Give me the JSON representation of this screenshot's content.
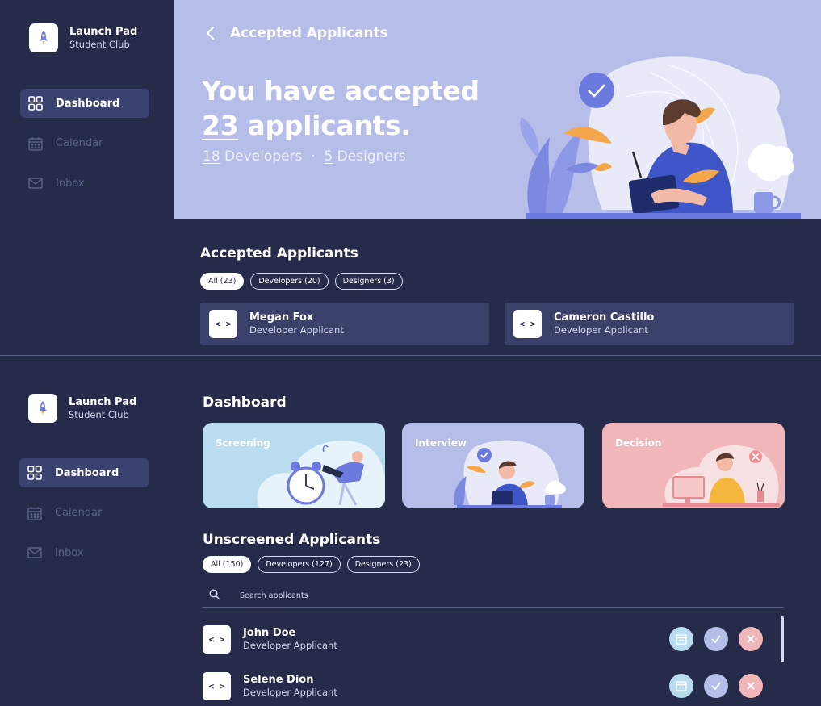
{
  "brand": {
    "name": "Launch Pad",
    "subtitle": "Student Club"
  },
  "nav": {
    "dashboard": "Dashboard",
    "calendar": "Calendar",
    "inbox": "Inbox"
  },
  "accepted_view": {
    "breadcrumb": "Accepted Applicants",
    "headline_prefix": "You have accepted",
    "headline_count": "23",
    "headline_suffix": " applicants.",
    "dev_count": "18",
    "dev_label": " Developers",
    "separator": "  ·  ",
    "design_count": "5",
    "design_label": " Designers",
    "section_title": "Accepted Applicants",
    "filters": [
      "All (23)",
      "Developers (20)",
      "Designers (3)"
    ],
    "applicants": [
      {
        "name": "Megan Fox",
        "role": "Developer Applicant",
        "icon": "< >"
      },
      {
        "name": "Cameron Castillo",
        "role": "Developer Applicant",
        "icon": "< >"
      }
    ]
  },
  "dashboard_view": {
    "title": "Dashboard",
    "stages": [
      "Screening",
      "Interview",
      "Decision"
    ],
    "section_title": "Unscreened Applicants",
    "filters": [
      "All (150)",
      "Developers (127)",
      "Designers (23)"
    ],
    "search": {
      "placeholder": "Search applicants"
    },
    "applicants": [
      {
        "name": "John Doe",
        "role": "Developer Applicant",
        "icon": "< >"
      },
      {
        "name": "Selene Dion",
        "role": "Developer Applicant",
        "icon": "< >"
      }
    ]
  },
  "colors": {
    "background": "#262b4a",
    "hero": "#b6bde9",
    "card": "#3a4069",
    "nav_active": "#3b4270",
    "screening": "#b9ddef",
    "interview": "#b6bde9",
    "decision": "#f0b6b9"
  }
}
